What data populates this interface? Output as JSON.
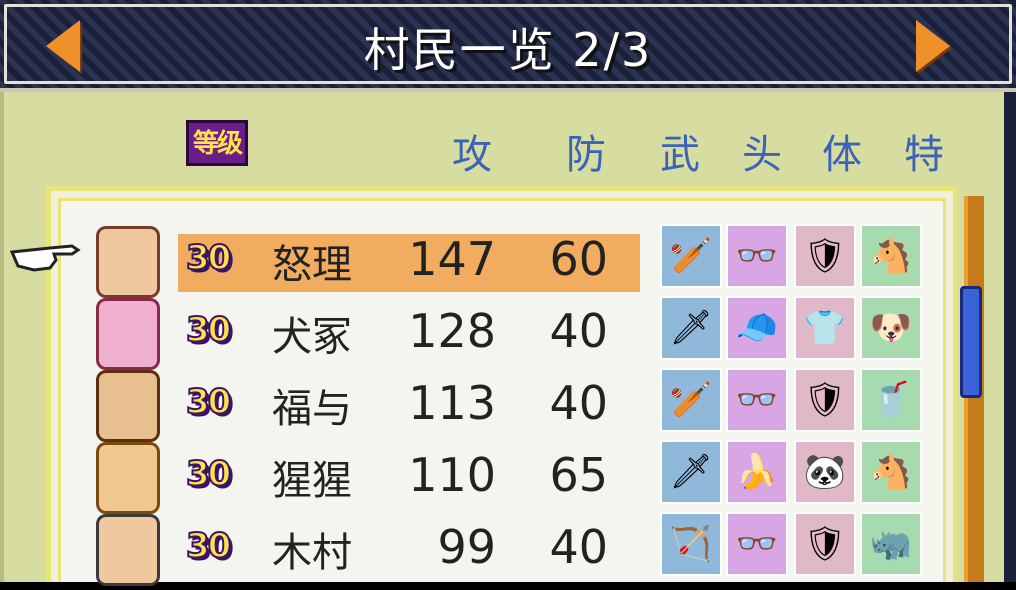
{
  "header": {
    "title": "村民一览 2/3"
  },
  "columns": {
    "level": "等级",
    "attack": "攻",
    "defense": "防",
    "weapon": "武",
    "head": "头",
    "body": "体",
    "special": "特"
  },
  "villagers": [
    {
      "level": "30",
      "name": "怒理",
      "attack": "147",
      "defense": "60",
      "weapon_icon": "club-icon",
      "head_icon": "glasses-icon",
      "body_icon": "armor-icon",
      "special_icon": "horse-icon"
    },
    {
      "level": "30",
      "name": "犬冢",
      "attack": "128",
      "defense": "40",
      "weapon_icon": "sword-icon",
      "head_icon": "red-cap-icon",
      "body_icon": "pink-suit-icon",
      "special_icon": "dog-icon"
    },
    {
      "level": "30",
      "name": "福与",
      "attack": "113",
      "defense": "40",
      "weapon_icon": "club-icon",
      "head_icon": "glasses-icon",
      "body_icon": "armor-icon",
      "special_icon": "drink-icon"
    },
    {
      "level": "30",
      "name": "猩猩",
      "attack": "110",
      "defense": "65",
      "weapon_icon": "sword-icon",
      "head_icon": "banana-icon",
      "body_icon": "panda-suit-icon",
      "special_icon": "horse-icon"
    },
    {
      "level": "30",
      "name": "木村",
      "attack": "99",
      "defense": "40",
      "weapon_icon": "bow-icon",
      "head_icon": "glasses-icon",
      "body_icon": "armor-icon",
      "special_icon": "rhino-icon"
    }
  ],
  "colors": {
    "highlight": "#f2ac60",
    "header_text": "#3b63b8",
    "panel": "#d7dca0"
  }
}
